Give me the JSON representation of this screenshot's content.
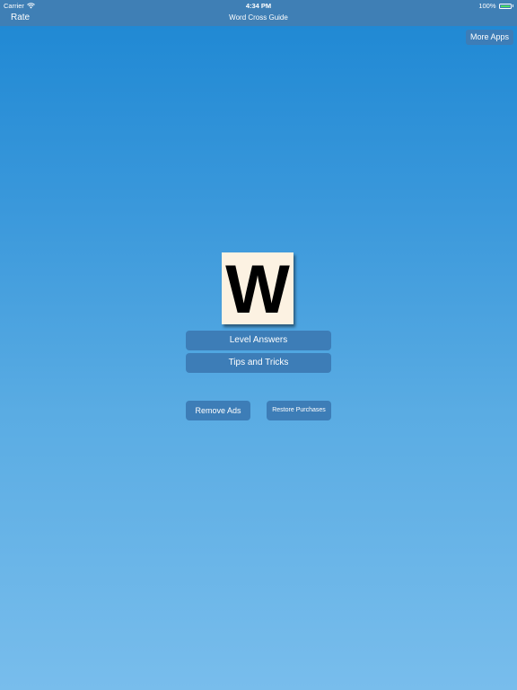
{
  "status_bar": {
    "carrier": "Carrier",
    "time": "4:34 PM",
    "battery_text": "100%",
    "battery_level": 1.0
  },
  "nav_bar": {
    "left_label": "Rate",
    "title": "Word Cross Guide"
  },
  "top_right_button": "More Apps",
  "logo": {
    "letter": "W"
  },
  "menu": {
    "level_answers": "Level Answers",
    "tips_and_tricks": "Tips and Tricks"
  },
  "purchases": {
    "remove_ads": "Remove Ads",
    "restore_purchases": "Restore Purchases"
  },
  "colors": {
    "bar": "#3f7fb5",
    "button": "#3d7db7",
    "gradient_top": "#1d87d3",
    "gradient_bottom": "#78bdec",
    "logo_tile": "#fcf2e2",
    "battery_green": "#4cd964"
  },
  "icons": {
    "wifi": "wifi-icon",
    "battery": "battery-icon"
  }
}
